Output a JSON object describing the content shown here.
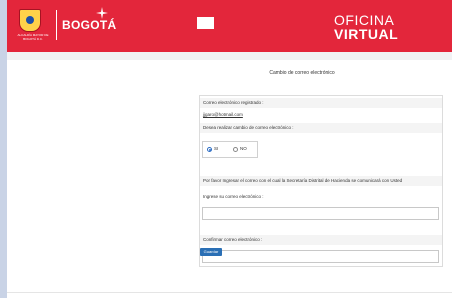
{
  "header": {
    "alcaldia_text": "ALCALDÍA MAYOR DE BOGOTÁ D.C.",
    "brand": "BOGOTÁ",
    "app_title_line1": "OFICINA",
    "app_title_line2": "VIRTUAL"
  },
  "page": {
    "title": "Cambio de correo electrónico"
  },
  "form": {
    "registered_label": "Correo electrónico registrado :",
    "registered_value": "jjgaro@hotmail.com",
    "change_question": "Desea realizar cambio de correo electrónico :",
    "option_si": "SI",
    "option_no": "NO",
    "selected_option": "SI",
    "info_text": "Por favor Ingresar el correo con el cual la Secretaría Distrital de Hacienda se comunicará con Usted",
    "new_email_label": "Ingrese su correo electrónico :",
    "new_email_value": "",
    "confirm_email_label": "Confirmar correo electrónico :",
    "confirm_email_value": "",
    "save_label": "Guardar"
  },
  "colors": {
    "header_red": "#e3263b",
    "button_blue": "#2a6fb5"
  }
}
